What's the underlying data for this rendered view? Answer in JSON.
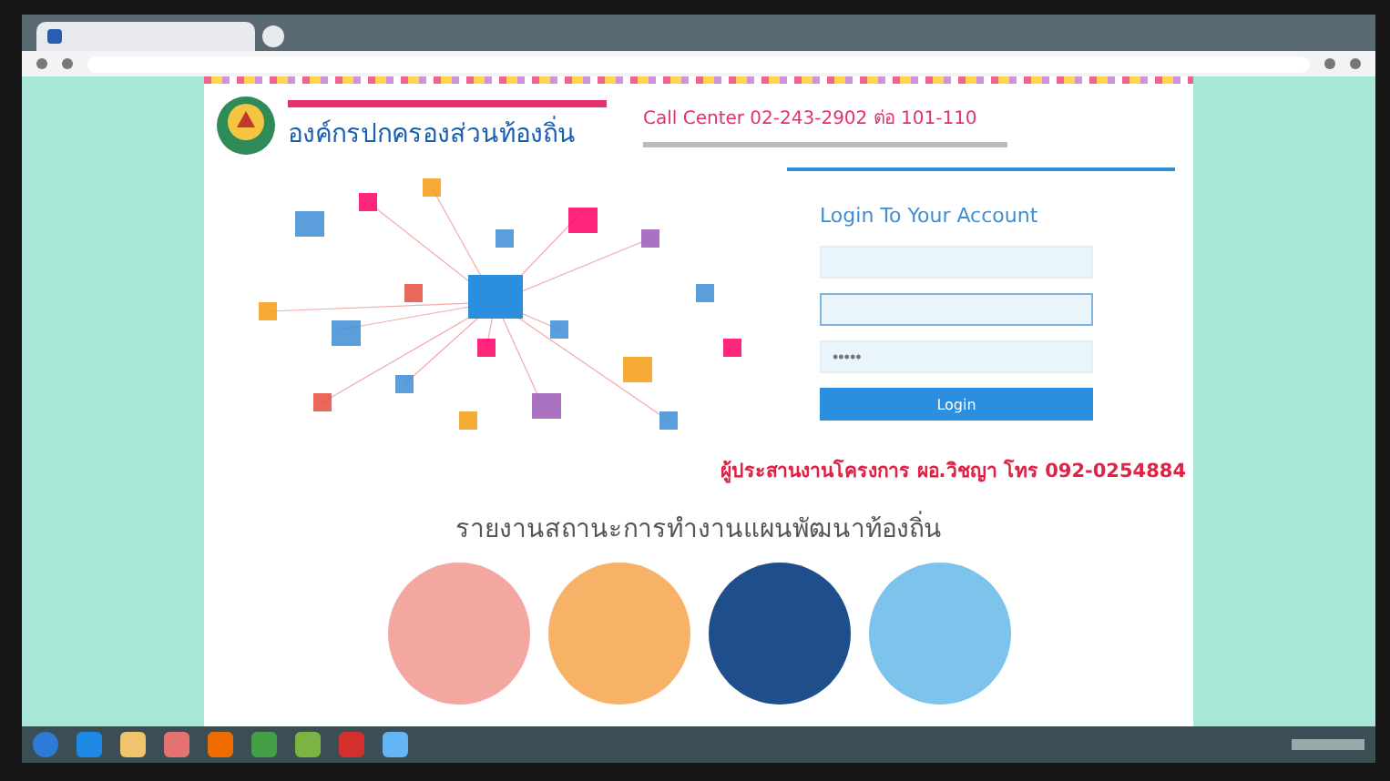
{
  "header": {
    "org_name": "องค์กรปกครองส่วนท้องถิ่น",
    "call_center": "Call Center 02-243-2902 ต่อ 101-110"
  },
  "login": {
    "title": "Login To Your Account",
    "fields": [
      {
        "focused": false
      },
      {
        "focused": true
      },
      {
        "value": "•••••",
        "focused": false
      }
    ],
    "button": "Login"
  },
  "coordinator": "ผู้ประสานงานโครงการ ผอ.วิชญา โทร 092-0254884",
  "report_title": "รายงานสถานะการทำงานแผนพัฒนาท้องถิ่น",
  "report_circles": [
    {
      "color": "#f4a6a0"
    },
    {
      "color": "#f7b267"
    },
    {
      "color": "#1f4e8c"
    },
    {
      "color": "#7cc4ec"
    }
  ]
}
